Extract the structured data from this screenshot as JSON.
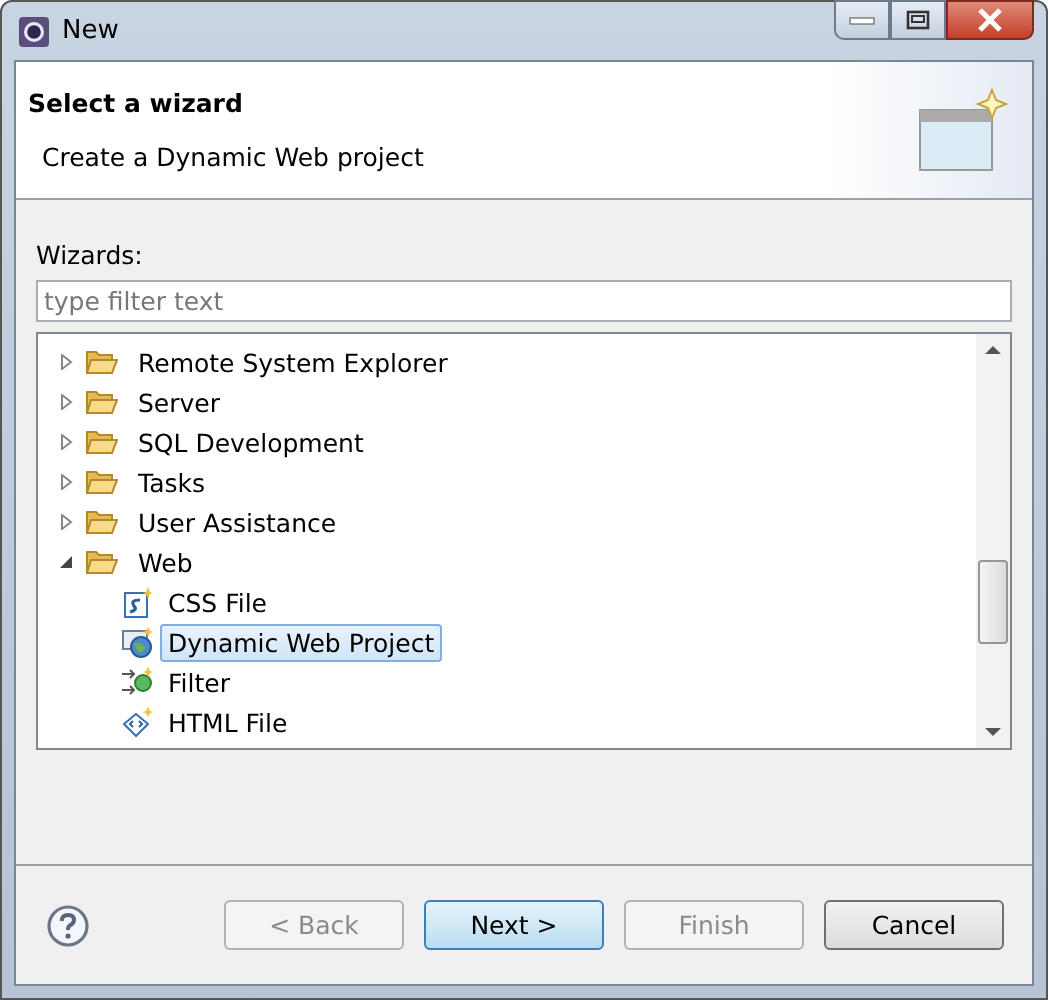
{
  "window": {
    "title": "New"
  },
  "header": {
    "title": "Select a wizard",
    "description": "Create a Dynamic Web project"
  },
  "wizards_label": "Wizards:",
  "filter": {
    "placeholder": "type filter text"
  },
  "tree": [
    {
      "label": "Remote System Explorer",
      "expanded": false,
      "selected": false,
      "kind": "folder"
    },
    {
      "label": "Server",
      "expanded": false,
      "selected": false,
      "kind": "folder"
    },
    {
      "label": "SQL Development",
      "expanded": false,
      "selected": false,
      "kind": "folder"
    },
    {
      "label": "Tasks",
      "expanded": false,
      "selected": false,
      "kind": "folder"
    },
    {
      "label": "User Assistance",
      "expanded": false,
      "selected": false,
      "kind": "folder"
    },
    {
      "label": "Web",
      "expanded": true,
      "selected": false,
      "kind": "folder",
      "children": [
        {
          "label": "CSS File",
          "selected": false,
          "kind": "css"
        },
        {
          "label": "Dynamic Web Project",
          "selected": true,
          "kind": "project"
        },
        {
          "label": "Filter",
          "selected": false,
          "kind": "filter"
        },
        {
          "label": "HTML File",
          "selected": false,
          "kind": "html"
        }
      ]
    }
  ],
  "buttons": [
    {
      "label": "< Back",
      "disabled": true,
      "default": false
    },
    {
      "label": "Next >",
      "disabled": false,
      "default": true
    },
    {
      "label": "Finish",
      "disabled": true,
      "default": false
    },
    {
      "label": "Cancel",
      "disabled": false,
      "default": false
    }
  ]
}
